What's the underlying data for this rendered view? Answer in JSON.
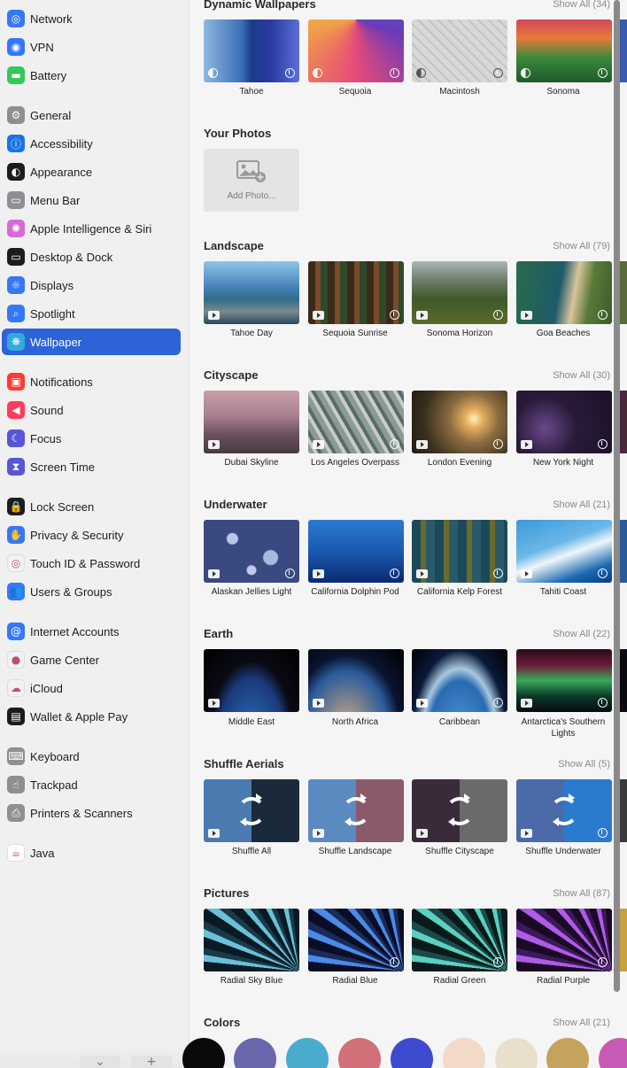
{
  "sidebar": {
    "items": [
      {
        "label": "Network",
        "icon": "network-icon",
        "color": "#3478f6",
        "glyph": "◎"
      },
      {
        "label": "VPN",
        "icon": "vpn-icon",
        "color": "#3478f6",
        "glyph": "◉"
      },
      {
        "label": "Battery",
        "icon": "battery-icon",
        "color": "#34c759",
        "glyph": "▬"
      },
      {
        "label": "General",
        "icon": "gear-icon",
        "color": "#8e8e93",
        "glyph": "⚙"
      },
      {
        "label": "Accessibility",
        "icon": "accessibility-icon",
        "color": "#1a73e8",
        "glyph": "ⓘ"
      },
      {
        "label": "Appearance",
        "icon": "appearance-icon",
        "color": "#1c1c1e",
        "glyph": "◐"
      },
      {
        "label": "Menu Bar",
        "icon": "menu-bar-icon",
        "color": "#8e8e93",
        "glyph": "▭"
      },
      {
        "label": "Apple Intelligence & Siri",
        "icon": "siri-icon",
        "color": "#d56bd6",
        "glyph": "✺"
      },
      {
        "label": "Desktop & Dock",
        "icon": "dock-icon",
        "color": "#1c1c1e",
        "glyph": "▭"
      },
      {
        "label": "Displays",
        "icon": "displays-icon",
        "color": "#3478f6",
        "glyph": "☼"
      },
      {
        "label": "Spotlight",
        "icon": "spotlight-icon",
        "color": "#3478f6",
        "glyph": "⌕"
      },
      {
        "label": "Wallpaper",
        "icon": "wallpaper-icon",
        "color": "#34aadc",
        "glyph": "❋"
      },
      {
        "label": "Notifications",
        "icon": "notifications-icon",
        "color": "#ff3b30",
        "glyph": "▣"
      },
      {
        "label": "Sound",
        "icon": "sound-icon",
        "color": "#ff3b5c",
        "glyph": "◀"
      },
      {
        "label": "Focus",
        "icon": "focus-icon",
        "color": "#5856d6",
        "glyph": "☾"
      },
      {
        "label": "Screen Time",
        "icon": "screen-time-icon",
        "color": "#5856d6",
        "glyph": "⧗"
      },
      {
        "label": "Lock Screen",
        "icon": "lock-icon",
        "color": "#1c1c1e",
        "glyph": "🔒"
      },
      {
        "label": "Privacy & Security",
        "icon": "hand-icon",
        "color": "#3478f6",
        "glyph": "✋"
      },
      {
        "label": "Touch ID & Password",
        "icon": "fingerprint-icon",
        "color": "#f2f2f2",
        "glyph": "◎"
      },
      {
        "label": "Users & Groups",
        "icon": "users-icon",
        "color": "#3478f6",
        "glyph": "👥"
      },
      {
        "label": "Internet Accounts",
        "icon": "at-icon",
        "color": "#3478f6",
        "glyph": "@"
      },
      {
        "label": "Game Center",
        "icon": "game-center-icon",
        "color": "#f2f2f2",
        "glyph": "●"
      },
      {
        "label": "iCloud",
        "icon": "icloud-icon",
        "color": "#f2f2f2",
        "glyph": "☁"
      },
      {
        "label": "Wallet & Apple Pay",
        "icon": "wallet-icon",
        "color": "#1c1c1e",
        "glyph": "▤"
      },
      {
        "label": "Keyboard",
        "icon": "keyboard-icon",
        "color": "#8e8e93",
        "glyph": "⌨"
      },
      {
        "label": "Trackpad",
        "icon": "trackpad-icon",
        "color": "#8e8e93",
        "glyph": "☝"
      },
      {
        "label": "Printers & Scanners",
        "icon": "printer-icon",
        "color": "#8e8e93",
        "glyph": "⎙"
      },
      {
        "label": "Java",
        "icon": "java-icon",
        "color": "#ffffff",
        "glyph": "☕"
      }
    ],
    "selected": "Wallpaper"
  },
  "sections": {
    "dynamic": {
      "title": "Dynamic Wallpapers",
      "show_all": "Show All (34)",
      "items": [
        "Tahoe",
        "Sequoia",
        "Macintosh",
        "Sonoma"
      ]
    },
    "photos": {
      "title": "Your Photos",
      "add_label": "Add Photo..."
    },
    "landscape": {
      "title": "Landscape",
      "show_all": "Show All (79)",
      "items": [
        "Tahoe Day",
        "Sequoia Sunrise",
        "Sonoma Horizon",
        "Goa Beaches"
      ]
    },
    "cityscape": {
      "title": "Cityscape",
      "show_all": "Show All (30)",
      "items": [
        "Dubai Skyline",
        "Los Angeles Overpass",
        "London Evening",
        "New York Night"
      ]
    },
    "underwater": {
      "title": "Underwater",
      "show_all": "Show All (21)",
      "items": [
        "Alaskan Jellies Light",
        "California Dolphin Pod",
        "California Kelp Forest",
        "Tahiti Coast"
      ]
    },
    "earth": {
      "title": "Earth",
      "show_all": "Show All (22)",
      "items": [
        "Middle East",
        "North Africa",
        "Caribbean",
        "Antarctica's Southern Lights"
      ]
    },
    "shuffle": {
      "title": "Shuffle Aerials",
      "show_all": "Show All (5)",
      "items": [
        "Shuffle All",
        "Shuffle Landscape",
        "Shuffle Cityscape",
        "Shuffle Underwater"
      ]
    },
    "pictures": {
      "title": "Pictures",
      "show_all": "Show All (87)",
      "items": [
        "Radial Sky Blue",
        "Radial Blue",
        "Radial Green",
        "Radial Purple"
      ]
    },
    "colors": {
      "title": "Colors",
      "show_all": "Show All (21)",
      "swatches": [
        "#0a0a0a",
        "#6b67ad",
        "#4aaccc",
        "#d2707a",
        "#3c4bcf",
        "#f3d9c7",
        "#eadfcb",
        "#c5a25e",
        "#c65ab5"
      ]
    }
  }
}
